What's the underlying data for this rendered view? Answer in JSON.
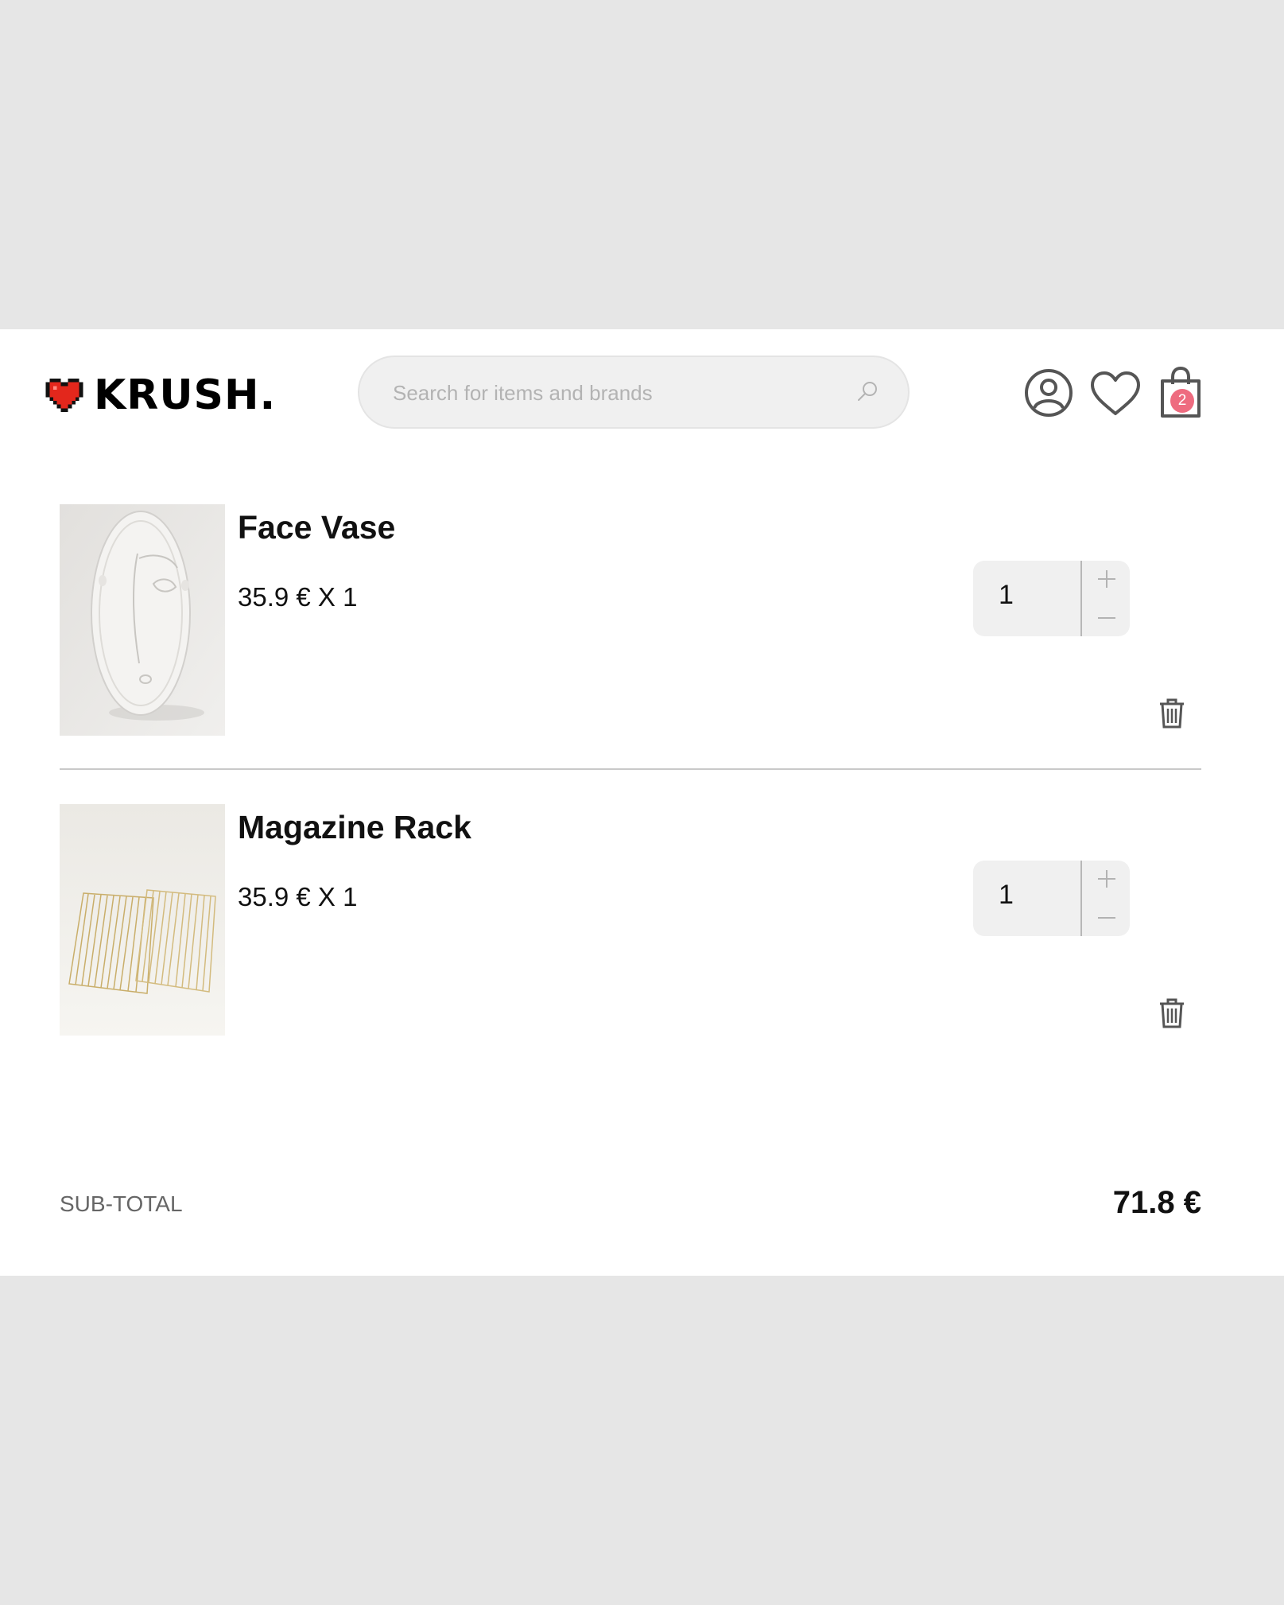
{
  "header": {
    "logo_text": "KRUSH.",
    "search": {
      "placeholder": "Search for items and brands",
      "value": ""
    },
    "icons": [
      "search-icon",
      "account-icon",
      "heart-icon",
      "bag-icon",
      "trash-icon"
    ],
    "bag_count": "2"
  },
  "cart": {
    "items": [
      {
        "name": "Face Vase",
        "price": "35.9 € X 1",
        "quantity": "1"
      },
      {
        "name": "Magazine Rack",
        "price": "35.9 € X 1",
        "quantity": "1"
      }
    ],
    "subtotal_label": "SUB-TOTAL",
    "subtotal_value": "71.8 €"
  },
  "colors": {
    "page_bg": "#e6e6e6",
    "panel_bg": "#ffffff",
    "logo_heart": "#e3271c",
    "badge": "#ee6b7f",
    "field_bg": "#f0f0f0"
  }
}
